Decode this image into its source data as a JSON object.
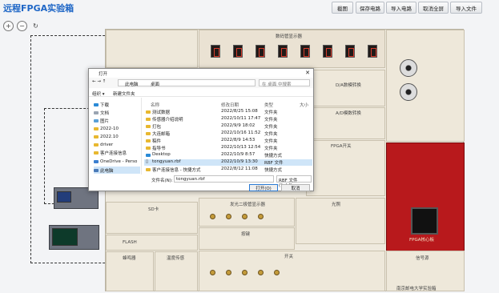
{
  "app": {
    "title": "远程FPGA实验箱"
  },
  "toolbar": {
    "buttons": [
      "截图",
      "保存电路",
      "导入电路",
      "取消全屏",
      "导入文件"
    ]
  },
  "zoom": {
    "in": "+",
    "out": "−",
    "reset": "↻"
  },
  "board_labels": {
    "seg_title": "数码管显示器",
    "dac": "D/A数模转换",
    "adc": "A/D模数转换",
    "fpga_switch": "FPGA开关",
    "fpga_board": "FPGA核心板",
    "light": "光照",
    "led": "发光二极管显示器",
    "sd": "SD卡",
    "flash": "FLASH",
    "buzzer": "蜂鸣器",
    "temp": "温度传感",
    "button": "按键",
    "switch": "开关",
    "signal": "信号源",
    "footer": "南京邮电大学实验箱"
  },
  "dialog": {
    "title": "打开",
    "breadcrumb": [
      "此电脑",
      "桌面"
    ],
    "search_placeholder": "在 桌面 中搜索",
    "organize": "组织 ▾",
    "new_folder": "新建文件夹",
    "columns": [
      "名称",
      "修改日期",
      "类型",
      "大小"
    ],
    "nav": [
      "下载",
      "文档",
      "图片",
      "2022-10",
      "2022.10",
      "driver",
      "客户连接信息",
      "OneDrive - Perso",
      "此电脑"
    ],
    "files": [
      {
        "name": "测试数据",
        "date": "2022/8/25 15:08",
        "type": "文件夹",
        "size": ""
      },
      {
        "name": "传感器介绍说明",
        "date": "2022/10/11 17:47",
        "type": "文件夹",
        "size": ""
      },
      {
        "name": "打包",
        "date": "2022/9/9 18:02",
        "type": "文件夹",
        "size": ""
      },
      {
        "name": "大连邮箱",
        "date": "2022/10/16 11:52",
        "type": "文件夹",
        "size": ""
      },
      {
        "name": "稿件",
        "date": "2022/8/9 14:53",
        "type": "文件夹",
        "size": ""
      },
      {
        "name": "指导书",
        "date": "2022/10/13 12:54",
        "type": "文件夹",
        "size": ""
      },
      {
        "name": "Desktop",
        "date": "2022/10/9 8:57",
        "type": "快捷方式",
        "size": ""
      },
      {
        "name": "tongyuan.rbf",
        "date": "2022/10/9 13:30",
        "type": "RBF 文件",
        "size": ""
      },
      {
        "name": "客户连接信息 - 快捷方式",
        "date": "2022/8/12 11:08",
        "type": "快捷方式",
        "size": ""
      }
    ],
    "filename_label": "文件名(N):",
    "filename_value": "tongyuan.rbf",
    "filetype": "RBF 文件 (*.rbf)",
    "open_button": "打开(O)",
    "cancel_button": "取消"
  }
}
